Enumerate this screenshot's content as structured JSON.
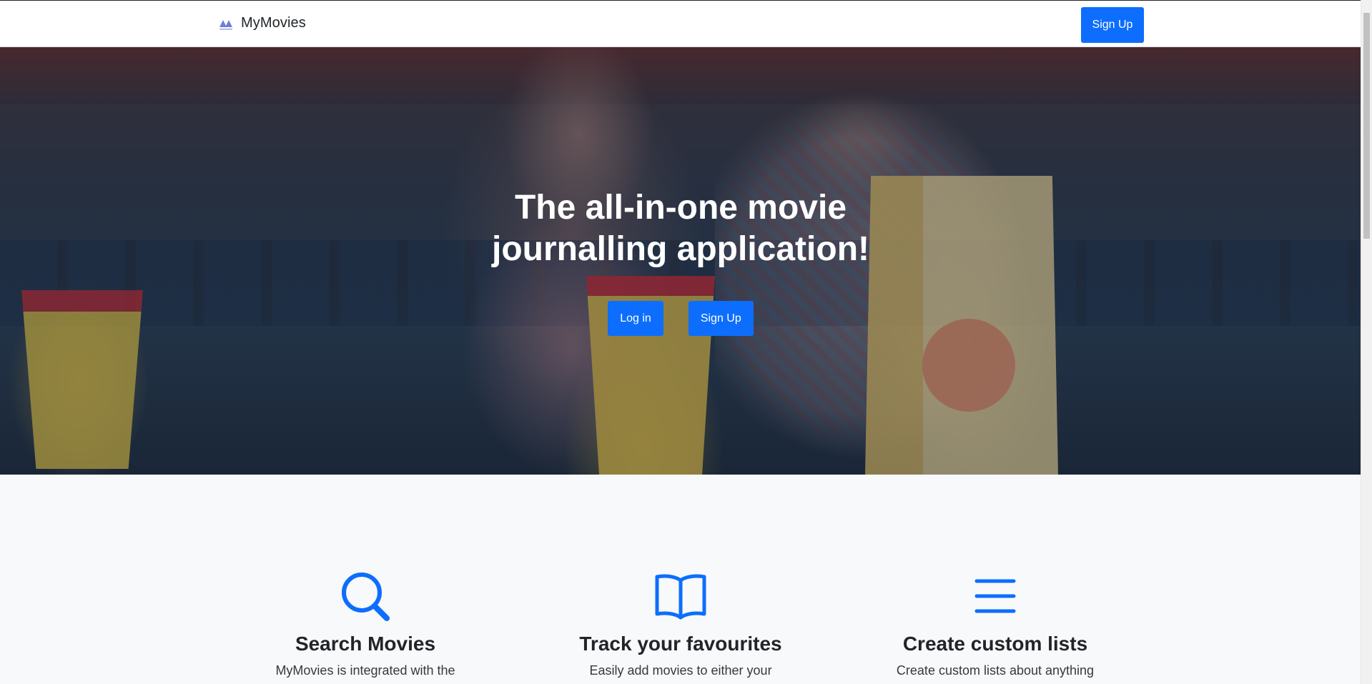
{
  "navbar": {
    "brand_name": "MyMovies",
    "brand_logo_icon": "mountains-logo-icon",
    "signup_label": "Sign Up"
  },
  "hero": {
    "title": "The all-in-one movie journalling application!",
    "login_label": "Log in",
    "signup_label": "Sign Up"
  },
  "features": [
    {
      "icon": "search-icon",
      "title": "Search Movies",
      "text": "MyMovies is integrated with the"
    },
    {
      "icon": "book-icon",
      "title": "Track your favourites",
      "text": "Easily add movies to either your"
    },
    {
      "icon": "list-icon",
      "title": "Create custom lists",
      "text": "Create custom lists about anything"
    }
  ],
  "colors": {
    "primary": "#0d6efd",
    "heading": "#212529",
    "background": "#f8f9fa"
  }
}
